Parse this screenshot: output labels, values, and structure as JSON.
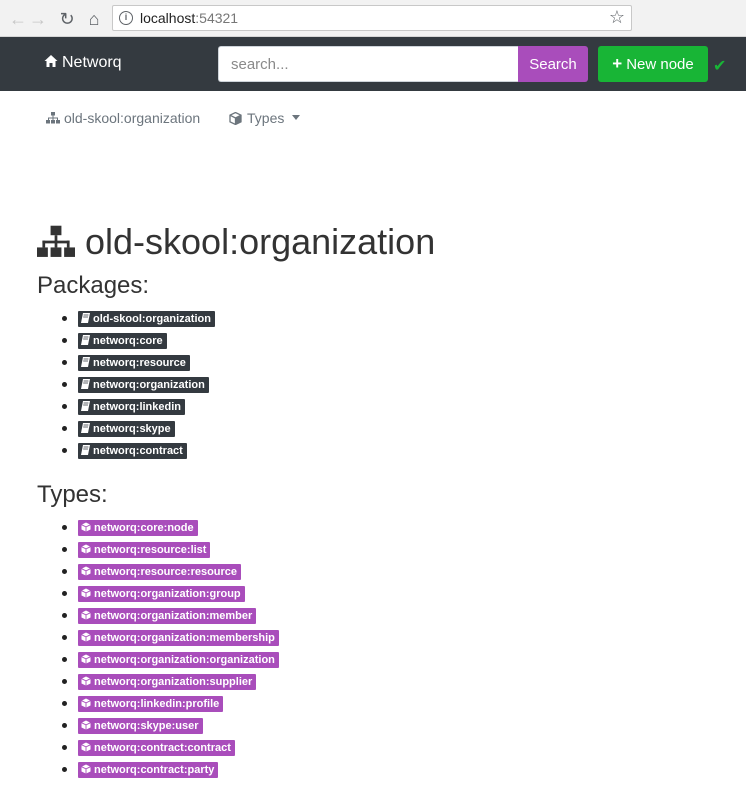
{
  "browser": {
    "url_host": "localhost",
    "url_port": ":54321"
  },
  "navbar": {
    "brand": "Networq",
    "search_placeholder": "search...",
    "search_button": "Search",
    "new_node_button": "New node"
  },
  "subnav": {
    "node_link": "old-skool:organization",
    "types_dropdown": "Types"
  },
  "main": {
    "title": "old-skool:organization",
    "packages_heading": "Packages:",
    "packages": [
      "old-skool:organization",
      "networq:core",
      "networq:resource",
      "networq:organization",
      "networq:linkedin",
      "networq:skype",
      "networq:contract"
    ],
    "types_heading": "Types:",
    "types": [
      "networq:core:node",
      "networq:resource:list",
      "networq:resource:resource",
      "networq:organization:group",
      "networq:organization:member",
      "networq:organization:membership",
      "networq:organization:organization",
      "networq:organization:supplier",
      "networq:linkedin:profile",
      "networq:skype:user",
      "networq:contract:contract",
      "networq:contract:party"
    ]
  },
  "colors": {
    "navbar_bg": "#343a40",
    "search_button": "#a94dbb",
    "new_node_button": "#18b536",
    "package_tag": "#343a40",
    "type_tag": "#a94dbb"
  },
  "icons": {
    "brand": "home-icon",
    "node": "sitemap-icon",
    "types": "cube-icon",
    "package_tag": "book-icon",
    "type_tag": "cube-icon",
    "status": "check-icon"
  }
}
